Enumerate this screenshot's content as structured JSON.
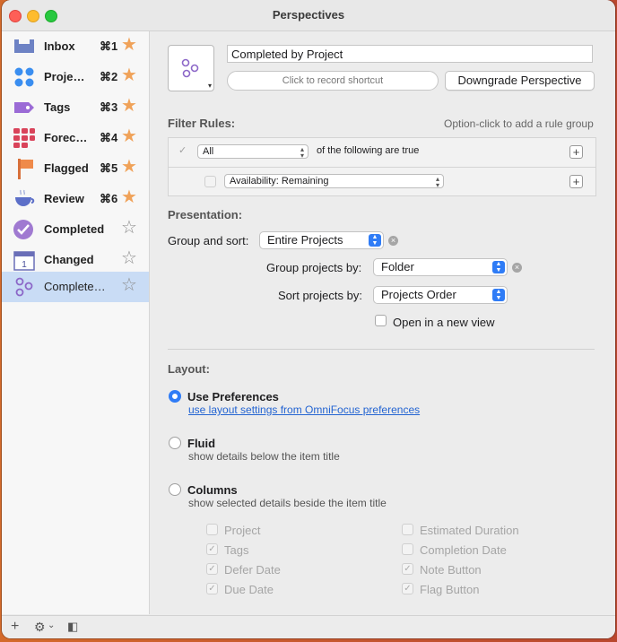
{
  "window": {
    "title": "Perspectives"
  },
  "sidebar": {
    "items": [
      {
        "label": "Inbox",
        "shortcut": "⌘1",
        "favorite": true,
        "icon": "inbox-icon"
      },
      {
        "label": "Proje…",
        "shortcut": "⌘2",
        "favorite": true,
        "icon": "projects-icon"
      },
      {
        "label": "Tags",
        "shortcut": "⌘3",
        "favorite": true,
        "icon": "tags-icon"
      },
      {
        "label": "Forec…",
        "shortcut": "⌘4",
        "favorite": true,
        "icon": "forecast-icon"
      },
      {
        "label": "Flagged",
        "shortcut": "⌘5",
        "favorite": true,
        "icon": "flag-icon"
      },
      {
        "label": "Review",
        "shortcut": "⌘6",
        "favorite": true,
        "icon": "review-icon"
      },
      {
        "label": "Completed",
        "shortcut": "",
        "favorite": false,
        "icon": "completed-icon"
      },
      {
        "label": "Changed",
        "shortcut": "",
        "favorite": false,
        "icon": "calendar-icon"
      },
      {
        "label": "Complete…",
        "shortcut": "",
        "favorite": false,
        "icon": "custom-perspective-icon",
        "selected": true
      }
    ],
    "star_filled": "★",
    "star_empty": "☆"
  },
  "bottom_bar": {
    "add": "+",
    "gear": "⚙",
    "gear_caret": "⌄",
    "sidebar_toggle": "◧"
  },
  "editor": {
    "name": "Completed by Project",
    "shortcut_placeholder": "Click to record shortcut",
    "downgrade_button": "Downgrade Perspective",
    "icon_caret": "▾"
  },
  "filter": {
    "section_title": "Filter Rules:",
    "hint": "Option-click to add a rule group",
    "match_value": "All",
    "match_suffix": "of the following are true",
    "rule_value": "Availability: Remaining",
    "add": "+"
  },
  "presentation": {
    "section_title": "Presentation:",
    "group_sort_label": "Group and sort:",
    "group_sort_value": "Entire Projects",
    "group_by_label": "Group projects by:",
    "group_by_value": "Folder",
    "sort_by_label": "Sort projects by:",
    "sort_by_value": "Projects Order",
    "new_view_label": "Open in a new view",
    "new_view_checked": false,
    "clear": "×"
  },
  "layout": {
    "section_title": "Layout:",
    "options": [
      {
        "label": "Use Preferences",
        "sub": "use layout settings from OmniFocus preferences",
        "selected": true,
        "sub_is_link": true
      },
      {
        "label": "Fluid",
        "sub": "show details below the item title",
        "selected": false
      },
      {
        "label": "Columns",
        "sub": "show selected details beside the item title",
        "selected": false
      }
    ],
    "columns_left": [
      {
        "label": "Project",
        "checked": false
      },
      {
        "label": "Tags",
        "checked": true
      },
      {
        "label": "Defer Date",
        "checked": true
      },
      {
        "label": "Due Date",
        "checked": true
      }
    ],
    "columns_right": [
      {
        "label": "Estimated Duration",
        "checked": false
      },
      {
        "label": "Completion Date",
        "checked": false
      },
      {
        "label": "Note Button",
        "checked": true
      },
      {
        "label": "Flag Button",
        "checked": true
      }
    ],
    "check_mark": "✓"
  },
  "colors": {
    "accent": "#2f7cf6",
    "star": "#f0a259",
    "selection": "#c9dcf5",
    "link": "#2364d2"
  }
}
